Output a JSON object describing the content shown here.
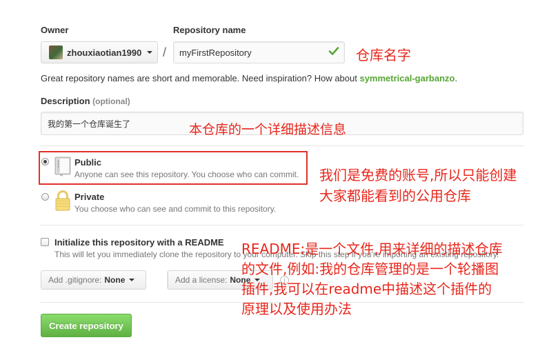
{
  "owner": {
    "label": "Owner",
    "value": "zhouxiaotian1990"
  },
  "repository": {
    "label": "Repository name",
    "separator": "/",
    "value": "myFirstRepository",
    "valid_icon": "check-icon"
  },
  "hint": {
    "text": "Great repository names are short and memorable. Need inspiration? How about ",
    "suggestion": "symmetrical-garbanzo",
    "end": "."
  },
  "description": {
    "label": "Description",
    "optional": "(optional)",
    "value": "我的第一个仓库诞生了"
  },
  "visibility": {
    "selected": "public",
    "public": {
      "title": "Public",
      "desc": "Anyone can see this repository. You choose who can commit.",
      "icon": "repo-book-icon"
    },
    "private": {
      "title": "Private",
      "desc": "You choose who can see and commit to this repository.",
      "icon": "lock-icon"
    }
  },
  "init": {
    "label": "Initialize this repository with a README",
    "desc": "This will let you immediately clone the repository to your computer. Skip this step if you're importing an existing repository.",
    "checked": false
  },
  "gitignore": {
    "prefix": "Add .gitignore:",
    "value": "None"
  },
  "license": {
    "prefix": "Add a license:",
    "value": "None",
    "info_icon": "info-icon"
  },
  "create_button": "Create repository",
  "annotations": {
    "repo_name": "仓库名字",
    "description": "本仓库的一个详细描述信息",
    "public_line1": "我们是免费的账号,所以只能创建",
    "public_line2": "大家都能看到的公用仓库",
    "readme_line1": "README:是一个文件,用来详细的描述仓库",
    "readme_line2": "的文件,例如:我的仓库管理的是一个轮播图",
    "readme_line3": "插件,我可以在readme中描述这个插件的",
    "readme_line4": "原理以及使用办法"
  },
  "colors": {
    "accent_green": "#55a532",
    "button_green": "#60b044",
    "annotation_red": "#e8271c"
  }
}
